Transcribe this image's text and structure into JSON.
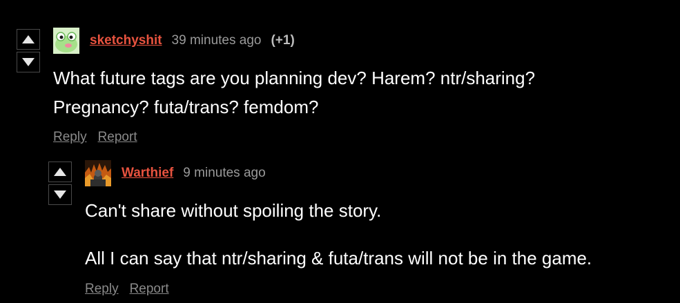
{
  "comments": [
    {
      "username": "sketchyshit",
      "time": "39 minutes ago",
      "score": "(+1)",
      "avatar": "frog-avatar",
      "paragraphs": [
        "What future tags are you planning dev? Harem? ntr/sharing?",
        "Pregnancy? futa/trans? femdom?"
      ],
      "reply_label": "Reply",
      "report_label": "Report"
    },
    {
      "username": "Warthief",
      "time": "9 minutes ago",
      "avatar": "warrior-fire-avatar",
      "paragraphs": [
        "Can't share without spoiling the story.",
        "All I can say that ntr/sharing & futa/trans will not be in the game."
      ],
      "reply_label": "Reply",
      "report_label": "Report"
    }
  ],
  "icons": {
    "upvote": "triangle-up-icon",
    "downvote": "triangle-down-icon"
  },
  "colors": {
    "background": "#000000",
    "username": "#e8533f",
    "meta": "#9a9a9a",
    "action_link": "#8a8a8a",
    "vote_border": "#4a4a4a"
  }
}
